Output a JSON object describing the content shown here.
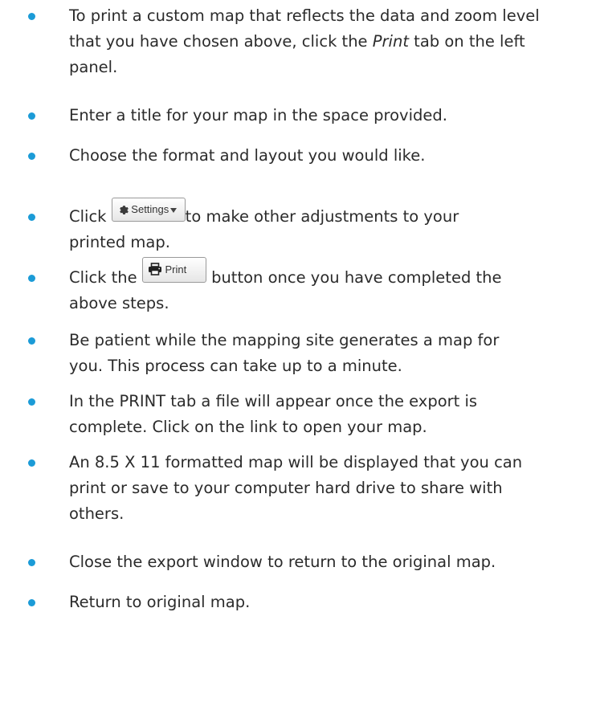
{
  "steps": [
    {
      "line1_pre": "To print a custom map that reflects the data and zoom level",
      "line2_pre": "that you have chosen above, click the ",
      "line2_em": "Print",
      "line2_post": " tab on the left",
      "line3": "panel."
    },
    {
      "line1": "Enter a title for your map in the space provided."
    },
    {
      "line1": "Choose the format and layout you would like."
    },
    {
      "line1_pre": "Click ",
      "line1_post": "to make other adjustments to your",
      "line2": "printed map."
    },
    {
      "line1_pre": "Click the ",
      "line1_post": " button once you have completed the",
      "line2": "above steps."
    },
    {
      "line1": "Be patient while the mapping site generates a map for",
      "line2": "you.  This process can take up to a minute."
    },
    {
      "line1": "In the PRINT tab a file will appear once the export is",
      "line2": "complete. Click on the link to open your map."
    },
    {
      "line1": "An 8.5 X 11 formatted map will be displayed that you can",
      "line2": "print or save to your computer hard drive to share with",
      "line3": "others."
    },
    {
      "line1": "Close the export window to return to the original map."
    },
    {
      "line1": "Return to original map."
    }
  ],
  "buttons": {
    "settings_label": "Settings",
    "settings_icon": "gear-icon",
    "print_label": "Print",
    "print_icon": "printer-icon"
  },
  "colors": {
    "bullet": "#1b9bd7",
    "text": "#2b2b2b"
  }
}
